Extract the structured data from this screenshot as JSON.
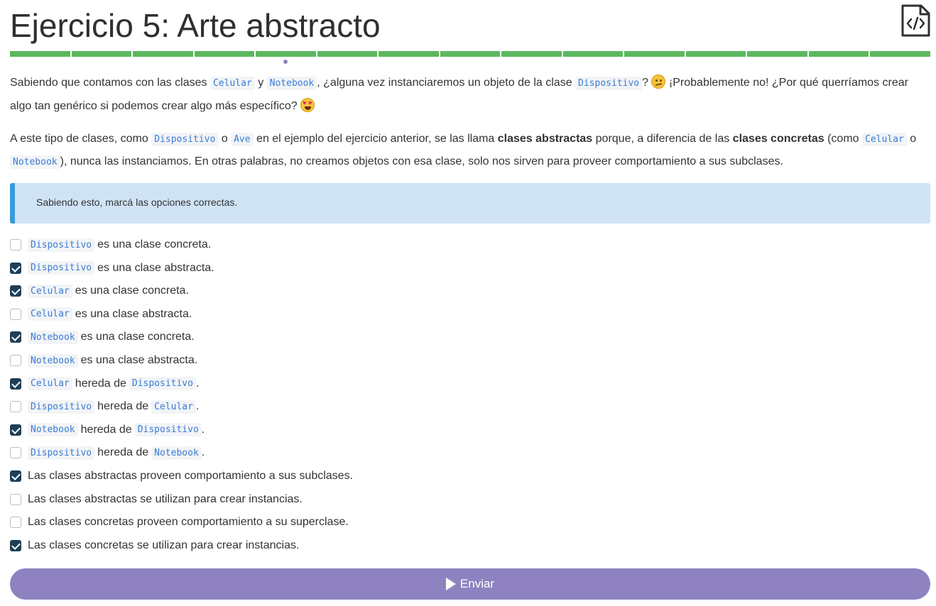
{
  "page": {
    "title": "Ejercicio 5: Arte abstracto"
  },
  "progress": {
    "segments": 15,
    "current": 4
  },
  "paragraph1": {
    "t1": "Sabiendo que contamos con las clases ",
    "c1": "Celular",
    "t2": " y ",
    "c2": "Notebook",
    "t3": ", ¿alguna vez instanciaremos un objeto de la clase ",
    "c3": "Dispositivo",
    "t4": "? ",
    "t5": " ¡Probablemente no! ¿Por qué querríamos crear algo tan genérico si podemos crear algo más específico? "
  },
  "paragraph2": {
    "t1": "A este tipo de clases, como ",
    "c1": "Dispositivo",
    "t2": " o ",
    "c2": "Ave",
    "t3": " en el ejemplo del ejercicio anterior, se las llama ",
    "b1": "clases abstractas",
    "t4": " porque, a diferencia de las ",
    "b2": "clases concretas",
    "t5": " (como ",
    "c3": "Celular",
    "t6": " o ",
    "c4": "Notebook",
    "t7": "), nunca las instanciamos. En otras palabras, no creamos objetos con esa clase, solo nos sirven para proveer comportamiento a sus subclases."
  },
  "info": {
    "text": "Sabiendo esto, marcá las opciones correctas."
  },
  "options": [
    {
      "code1": "Dispositivo",
      "text": "es una clase concreta.",
      "checked": false
    },
    {
      "code1": "Dispositivo",
      "text": "es una clase abstracta.",
      "checked": true
    },
    {
      "code1": "Celular",
      "text": "es una clase concreta.",
      "checked": true
    },
    {
      "code1": "Celular",
      "text": "es una clase abstracta.",
      "checked": false
    },
    {
      "code1": "Notebook",
      "text": "es una clase concreta.",
      "checked": true
    },
    {
      "code1": "Notebook",
      "text": "es una clase abstracta.",
      "checked": false
    },
    {
      "code1": "Celular",
      "text": "hereda de",
      "code2": "Dispositivo",
      "tail": ".",
      "checked": true
    },
    {
      "code1": "Dispositivo",
      "text": "hereda de",
      "code2": "Celular",
      "tail": ".",
      "checked": false
    },
    {
      "code1": "Notebook",
      "text": "hereda de",
      "code2": "Dispositivo",
      "tail": ".",
      "checked": true
    },
    {
      "code1": "Dispositivo",
      "text": "hereda de",
      "code2": "Notebook",
      "tail": ".",
      "checked": false
    },
    {
      "text": "Las clases abstractas proveen comportamiento a sus subclases.",
      "checked": true
    },
    {
      "text": "Las clases abstractas se utilizan para crear instancias.",
      "checked": false
    },
    {
      "text": "Las clases concretas proveen comportamiento a su superclase.",
      "checked": false
    },
    {
      "text": "Las clases concretas se utilizan para crear instancias.",
      "checked": true
    }
  ],
  "submit": {
    "label": "Enviar"
  },
  "icons": {
    "header": "code-file-icon",
    "submit": "play-icon"
  },
  "colors": {
    "accent": "#8e83c0",
    "progress": "#5cb85c",
    "checked": "#1f3f57",
    "info_bg": "#cfe3f5",
    "info_border": "#3a9ad9",
    "code": "#3a7bd5"
  }
}
